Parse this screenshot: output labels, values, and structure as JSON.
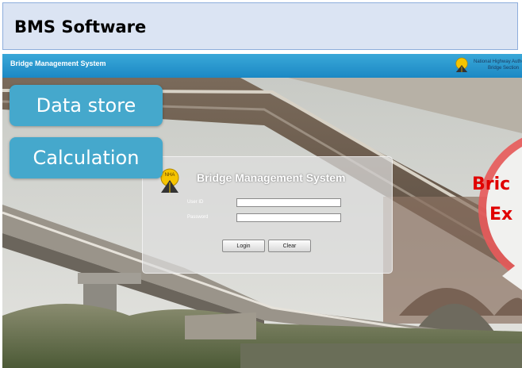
{
  "slide": {
    "title": "BMS Software"
  },
  "app": {
    "header_title": "Bridge Management System",
    "org_name_line1": "National Highway Authority",
    "org_name_line2": "Bridge Section",
    "logo_text": "NHA"
  },
  "login": {
    "title": "Bridge Management System",
    "userid_label": "User ID",
    "password_label": "Password",
    "userid_value": "",
    "password_value": "",
    "login_label": "Login",
    "clear_label": "Clear"
  },
  "callouts": {
    "data_store": "Data store",
    "calculation": "Calculation",
    "bubble_line1": "Bric",
    "bubble_line2": "Ex"
  },
  "colors": {
    "header": "#1b88c4",
    "callout": "#45a8cc",
    "bubble": "#e85a5a",
    "bubble_text": "#e00000"
  }
}
